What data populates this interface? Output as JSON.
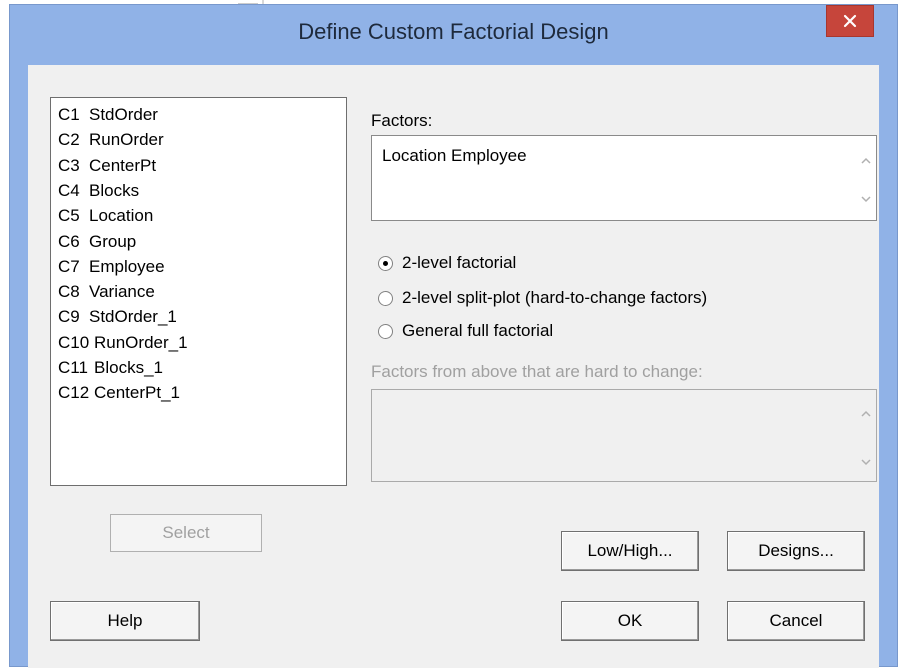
{
  "window": {
    "title": "Define Custom Factorial Design",
    "close_glyph": "✕"
  },
  "columns": [
    {
      "num": "C1",
      "name": "StdOrder"
    },
    {
      "num": "C2",
      "name": "RunOrder"
    },
    {
      "num": "C3",
      "name": "CenterPt"
    },
    {
      "num": "C4",
      "name": "Blocks"
    },
    {
      "num": "C5",
      "name": "Location"
    },
    {
      "num": "C6",
      "name": "Group"
    },
    {
      "num": "C7",
      "name": "Employee"
    },
    {
      "num": "C8",
      "name": "Variance"
    },
    {
      "num": "C9",
      "name": "StdOrder_1"
    },
    {
      "num": "C10",
      "name": "RunOrder_1"
    },
    {
      "num": "C11",
      "name": "Blocks_1"
    },
    {
      "num": "C12",
      "name": "CenterPt_1"
    }
  ],
  "factors": {
    "label": "Factors:",
    "value": "Location Employee"
  },
  "design_type": {
    "options": [
      {
        "label": "2-level factorial",
        "checked": true
      },
      {
        "label": "2-level split-plot (hard-to-change factors)",
        "checked": false
      },
      {
        "label": "General full factorial",
        "checked": false
      }
    ]
  },
  "hard_to_change": {
    "label": "Factors from above that are hard to change:",
    "value": ""
  },
  "buttons": {
    "select": "Select",
    "low_high": "Low/High...",
    "designs": "Designs...",
    "help": "Help",
    "ok": "OK",
    "cancel": "Cancel"
  },
  "colors": {
    "frame": "#90b2e7",
    "close": "#c6453b",
    "client": "#f0f0f0"
  }
}
